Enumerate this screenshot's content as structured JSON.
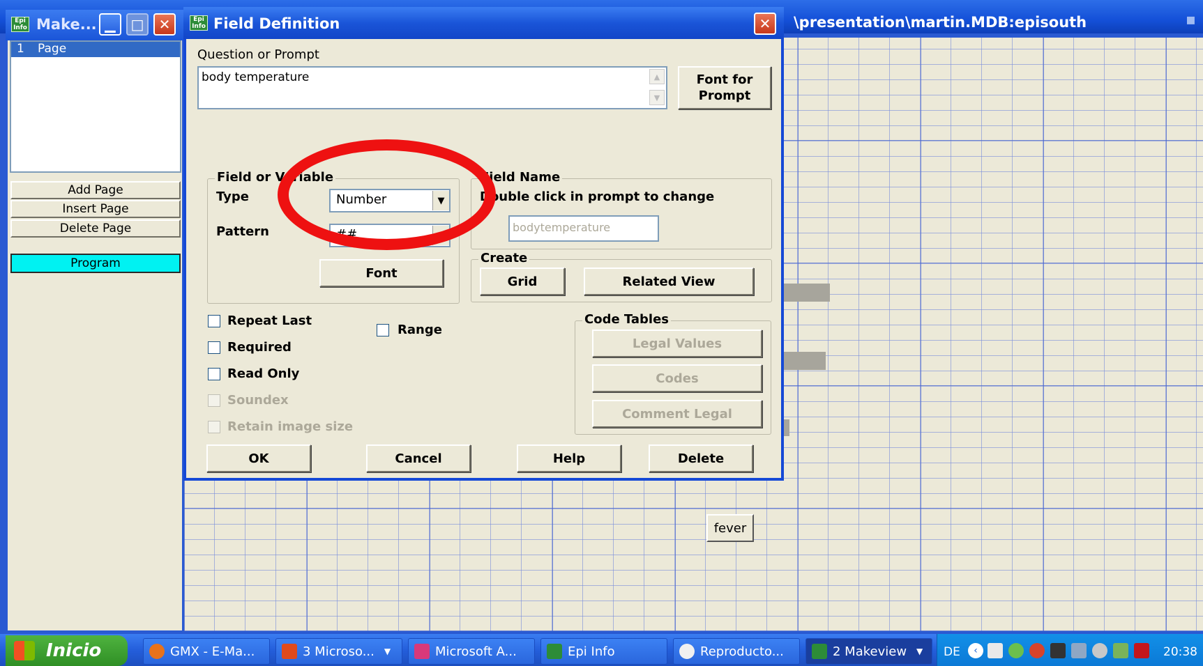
{
  "background_window": {
    "title": "\\presentation\\martin.MDB:episouth",
    "field_button_label": "fever"
  },
  "left_window": {
    "title": "Make...",
    "pages": [
      {
        "number": "1",
        "name": "Page"
      }
    ],
    "buttons": {
      "add_page": "Add Page",
      "insert_page": "Insert Page",
      "delete_page": "Delete Page",
      "program": "Program"
    },
    "program_color": "#00f2f2"
  },
  "dialog": {
    "title": "Field Definition",
    "prompt_label": "Question or Prompt",
    "prompt_value": "body temperature",
    "font_for_prompt": "Font for Prompt",
    "field_group": {
      "label": "Field or Variable",
      "type_label": "Type",
      "type_value": "Number",
      "pattern_label": "Pattern",
      "pattern_value": "##",
      "font_button": "Font"
    },
    "field_name_group": {
      "label": "Field Name",
      "hint": "Double click in prompt to change",
      "value": "bodytemperature"
    },
    "create_group": {
      "label": "Create",
      "grid_button": "Grid",
      "related_view_button": "Related View"
    },
    "checkboxes": {
      "repeat_last": "Repeat Last",
      "range": "Range",
      "required": "Required",
      "read_only": "Read Only",
      "soundex": "Soundex",
      "retain_image_size": "Retain image size"
    },
    "code_tables": {
      "label": "Code Tables",
      "legal_values": "Legal Values",
      "codes": "Codes",
      "comment_legal": "Comment Legal"
    },
    "buttons": {
      "ok": "OK",
      "cancel": "Cancel",
      "help": "Help",
      "delete": "Delete"
    },
    "annotation_color": "#ee1111"
  },
  "taskbar": {
    "start_label": "Inicio",
    "items": [
      {
        "label": "GMX - E-Ma..."
      },
      {
        "label": "3 Microso..."
      },
      {
        "label": "Microsoft A..."
      },
      {
        "label": "Epi Info"
      },
      {
        "label": "Reproducto..."
      },
      {
        "label": "2 Makeview"
      }
    ],
    "language": "DE",
    "clock": "20:38"
  }
}
